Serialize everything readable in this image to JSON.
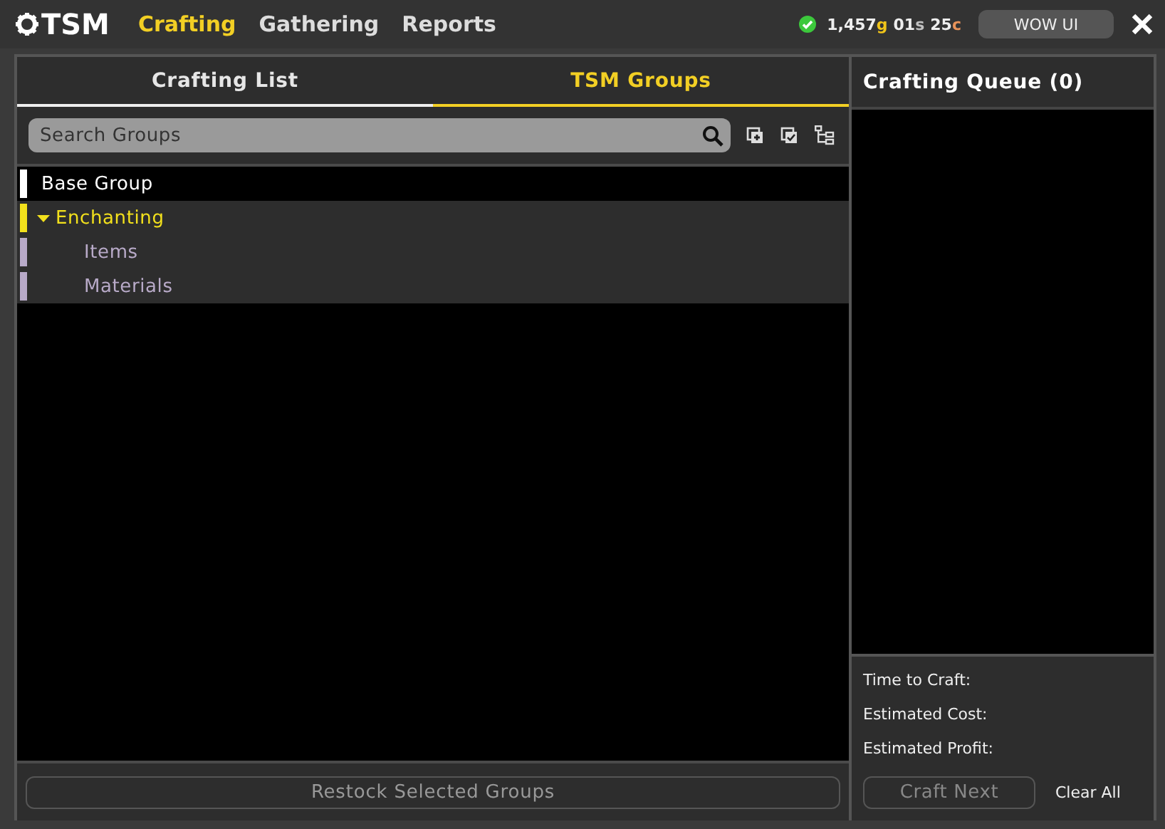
{
  "topbar": {
    "logo": "TSM",
    "nav": [
      {
        "label": "Crafting",
        "selected": true
      },
      {
        "label": "Gathering",
        "selected": false
      },
      {
        "label": "Reports",
        "selected": false
      }
    ],
    "money": [
      {
        "amount": "1,457",
        "unit": "g",
        "color": "#f0c419"
      },
      {
        "amount": "01",
        "unit": "s",
        "color": "#c0c0c0"
      },
      {
        "amount": "25",
        "unit": "c",
        "color": "#e8935a"
      }
    ],
    "app_button": "WOW UI"
  },
  "tabs": [
    {
      "label": "Crafting List",
      "selected": false
    },
    {
      "label": "TSM Groups",
      "selected": true
    }
  ],
  "search": {
    "placeholder": "Search Groups"
  },
  "groups": [
    {
      "name": "Base Group",
      "color": "#ffffff",
      "selected": false
    },
    {
      "name": "Enchanting",
      "color": "#f2e01c",
      "selected": true,
      "expanded": true,
      "children": [
        {
          "name": "Items",
          "color": "#b8aac8",
          "selected": true
        },
        {
          "name": "Materials",
          "color": "#b8aac8",
          "selected": true
        }
      ]
    }
  ],
  "restock_button": "Restock Selected Groups",
  "queue": {
    "title": "Crafting Queue (0)",
    "stats": [
      "Time to Craft:",
      "Estimated Cost:",
      "Estimated Profit:"
    ],
    "craft_button": {
      "label": "Craft Next",
      "disabled": true
    },
    "clear_button": "Clear All"
  }
}
